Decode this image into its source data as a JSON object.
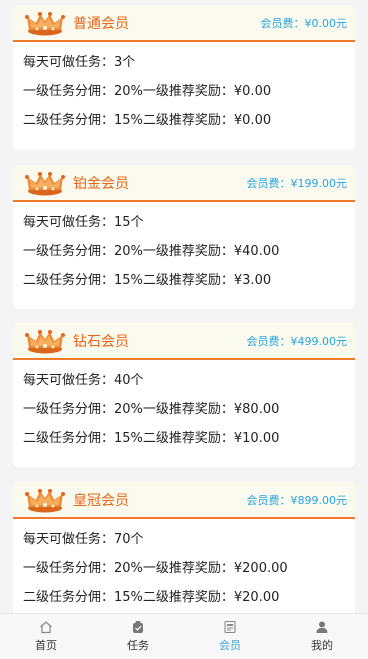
{
  "cards": [
    {
      "tier": "普通会员",
      "fee": "会员费：¥0.00元",
      "rows": [
        "每天可做任务：3个",
        "一级任务分佣：20%一级推荐奖励：¥0.00",
        "二级任务分佣：15%二级推荐奖励：¥0.00"
      ]
    },
    {
      "tier": "铂金会员",
      "fee": "会员费：¥199.00元",
      "rows": [
        "每天可做任务：15个",
        "一级任务分佣：20%一级推荐奖励：¥40.00",
        "二级任务分佣：15%二级推荐奖励：¥3.00"
      ]
    },
    {
      "tier": "钻石会员",
      "fee": "会员费：¥499.00元",
      "rows": [
        "每天可做任务：40个",
        "一级任务分佣：20%一级推荐奖励：¥80.00",
        "二级任务分佣：15%二级推荐奖励：¥10.00"
      ]
    },
    {
      "tier": "皇冠会员",
      "fee": "会员费：¥899.00元",
      "rows": [
        "每天可做任务：70个",
        "一级任务分佣：20%一级推荐奖励：¥200.00",
        "二级任务分佣：15%二级推荐奖励：¥20.00"
      ]
    }
  ],
  "tabbar": {
    "items": [
      {
        "label": "首页",
        "icon": "home-icon"
      },
      {
        "label": "任务",
        "icon": "task-icon"
      },
      {
        "label": "会员",
        "icon": "member-icon"
      },
      {
        "label": "我的",
        "icon": "user-icon"
      }
    ],
    "active_index": 2
  },
  "colors": {
    "accent_orange": "#e8651a",
    "fee_blue": "#26a5e0",
    "header_bg": "#fbfaee",
    "active_tab": "#3ea6d8"
  }
}
